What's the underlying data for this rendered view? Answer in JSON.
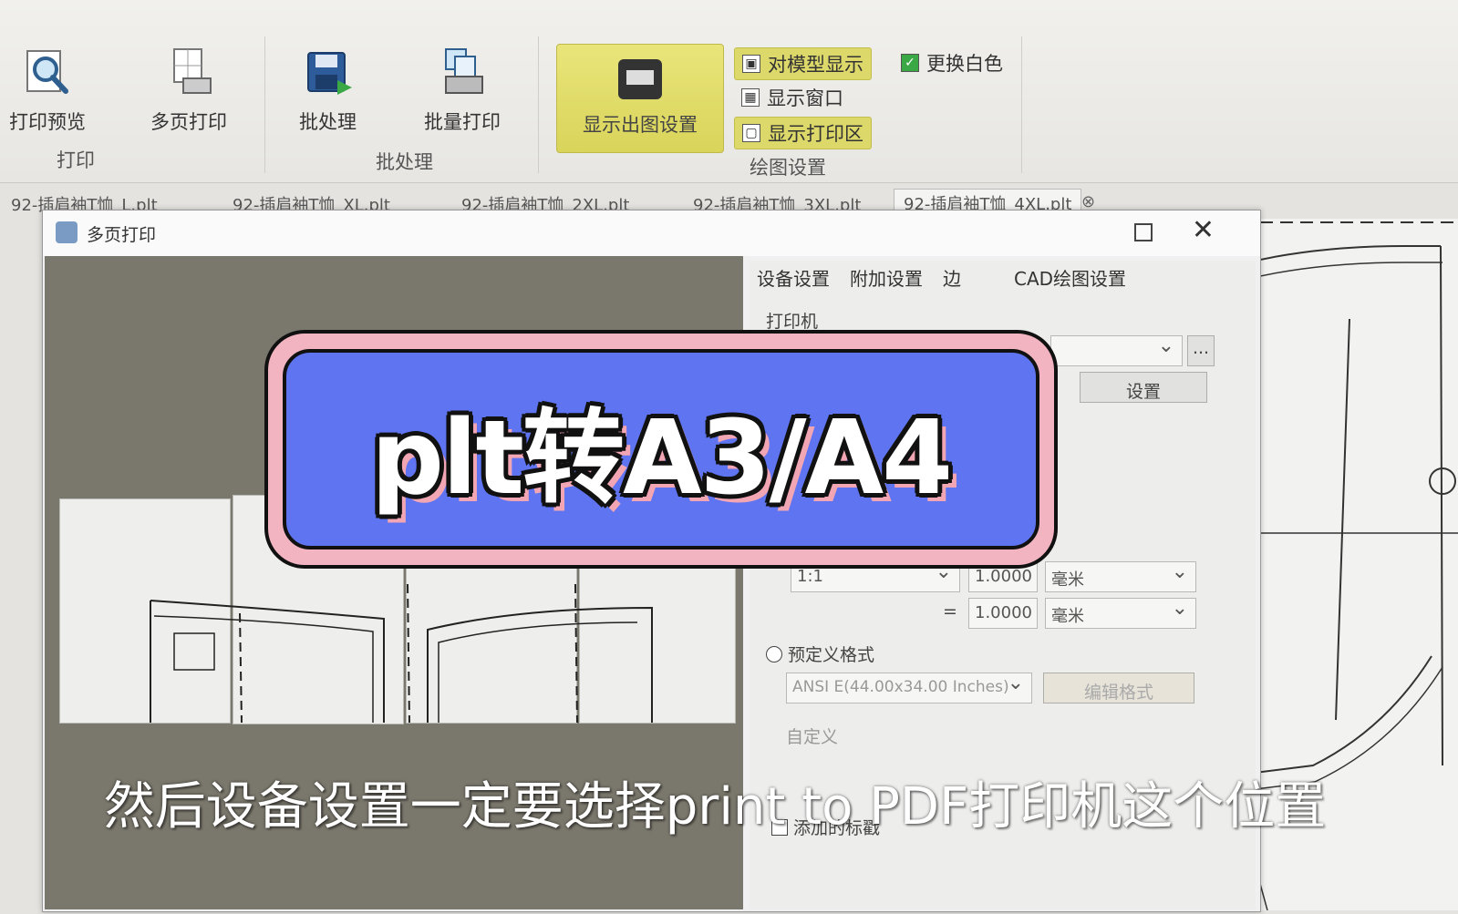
{
  "ribbon": {
    "print_preview": "打印预览",
    "multi_page_print": "多页打印",
    "batch_process": "批处理",
    "batch_print": "批量打印",
    "group_print": "打印",
    "group_batch": "批处理",
    "display_output_settings": "显示出图设置",
    "model_display": "对模型显示",
    "show_window": "显示窗口",
    "show_print_area": "显示打印区",
    "change_white": "更换白色",
    "group_drawing": "绘图设置"
  },
  "file_tabs": [
    "92-插肩袖T恤_L.plt",
    "92-插肩袖T恤_XL.plt",
    "92-插肩袖T恤_2XL.plt",
    "92-插肩袖T恤_3XL.plt",
    "92-插肩袖T恤_4XL.plt"
  ],
  "dialog": {
    "title": "多页打印",
    "tabs": [
      "设备设置",
      "附加设置",
      "边",
      "CAD绘图设置"
    ],
    "printer_group": "打印机",
    "printer_browse": "...",
    "setup_button": "设置",
    "scale_ratio": "1:1",
    "scale_value_1": "1.0000",
    "scale_value_2": "1.0000",
    "equals": "=",
    "unit_1": "毫米",
    "unit_2": "毫米",
    "predefined_format": "预定义格式",
    "paper_format": "ANSI E(44.00x34.00 Inches)",
    "edit_format": "编辑格式",
    "custom": "自定义",
    "add_stamp": "添加的标戳"
  },
  "overlay": {
    "banner": "plt转A3/A4",
    "subtitle": "然后设备设置一定要选择print to PDF打印机这个位置"
  },
  "colors": {
    "banner_blue": "#5e74f0",
    "banner_pink": "#f2b4c0",
    "highlight_yellow": "#ddd86a",
    "preview_bg": "#7a776c"
  }
}
